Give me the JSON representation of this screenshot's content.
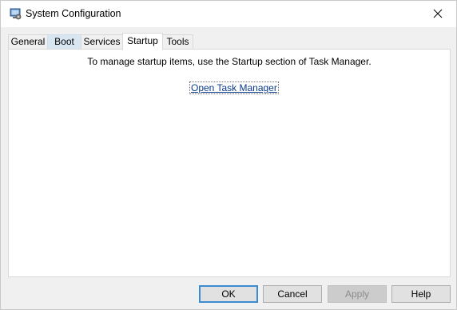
{
  "window": {
    "title": "System Configuration",
    "icon": "msconfig-icon",
    "close_icon": "close-icon"
  },
  "tabs": [
    {
      "label": "General",
      "state": "normal"
    },
    {
      "label": "Boot",
      "state": "hover"
    },
    {
      "label": "Services",
      "state": "normal"
    },
    {
      "label": "Startup",
      "state": "selected"
    },
    {
      "label": "Tools",
      "state": "normal"
    }
  ],
  "startup_panel": {
    "message": "To manage startup items, use the Startup section of Task Manager.",
    "link_label": "Open Task Manager"
  },
  "buttons": {
    "ok": "OK",
    "cancel": "Cancel",
    "apply": "Apply",
    "help": "Help"
  },
  "colors": {
    "link": "#0a3a8a",
    "default_button_border": "#3b8bd5",
    "selected_tab_background": "#ffffff",
    "hover_tab_background": "#d8e6f2"
  }
}
